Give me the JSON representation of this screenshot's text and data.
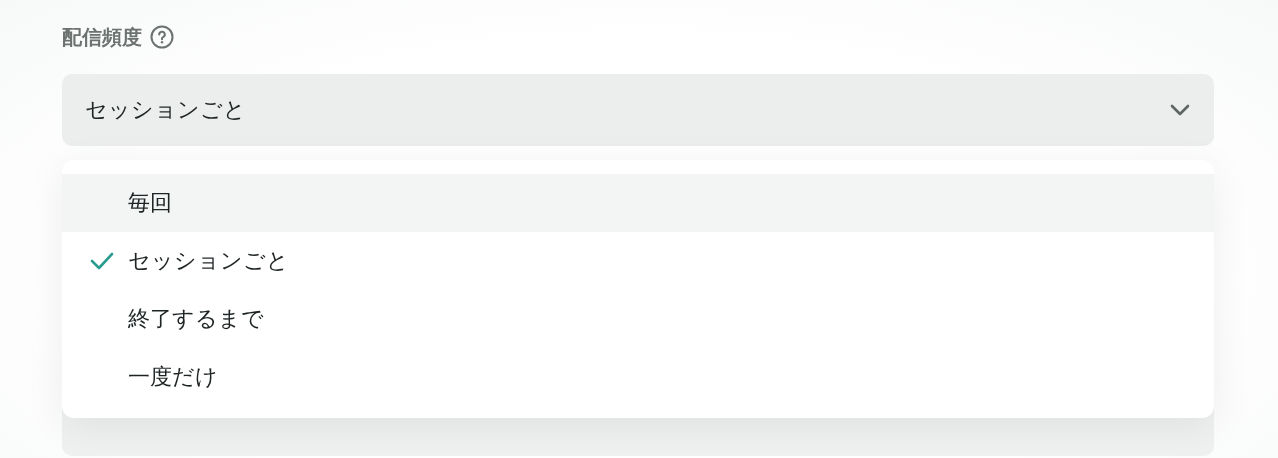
{
  "field": {
    "label": "配信頻度",
    "value": "セッションごと",
    "expanded": true
  },
  "options": [
    {
      "label": "毎回",
      "selected": false,
      "highlighted": true
    },
    {
      "label": "セッションごと",
      "selected": true,
      "highlighted": false
    },
    {
      "label": "終了するまで",
      "selected": false,
      "highlighted": false
    },
    {
      "label": "一度だけ",
      "selected": false,
      "highlighted": false
    }
  ]
}
